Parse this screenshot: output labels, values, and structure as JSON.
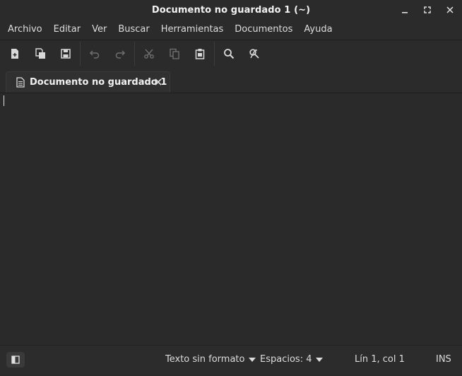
{
  "window": {
    "title": "Documento no guardado 1 (~)",
    "controls": [
      "minimize-icon",
      "maximize-icon",
      "close-icon"
    ]
  },
  "menubar": {
    "items": [
      "Archivo",
      "Editar",
      "Ver",
      "Buscar",
      "Herramientas",
      "Documentos",
      "Ayuda"
    ]
  },
  "toolbar": {
    "icons": [
      "new-document-icon",
      "open-document-icon",
      "save-icon",
      "undo-icon",
      "redo-icon",
      "cut-icon",
      "copy-icon",
      "paste-icon",
      "search-icon",
      "search-replace-icon"
    ]
  },
  "tabs": [
    {
      "label": "Documento no guardado 1",
      "icon": "document-icon"
    }
  ],
  "editor": {
    "content": ""
  },
  "statusbar": {
    "language": "Texto sin formato",
    "indent": "Espacios: 4",
    "cursor_position": "Lín 1, col 1",
    "mode": "INS"
  },
  "colors": {
    "background": "#2a2a2a",
    "chrome": "#2b2b2b",
    "text": "#e6e6e6"
  }
}
